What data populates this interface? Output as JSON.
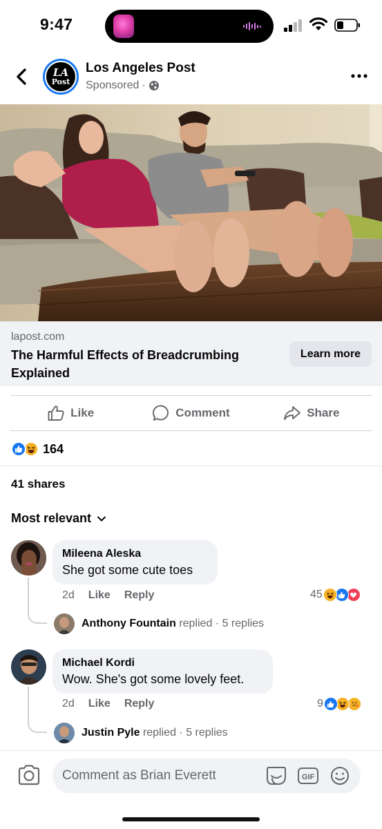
{
  "status_bar": {
    "time": "9:47"
  },
  "post": {
    "page_name": "Los Angeles Post",
    "logo_text_top": "LA",
    "logo_text_bottom": "Post",
    "sponsored_label": "Sponsored",
    "separator": "·",
    "link": {
      "domain": "lapost.com",
      "title": "The Harmful Effects of Breadcrumbing Explained",
      "cta": "Learn more"
    },
    "actions": {
      "like": "Like",
      "comment": "Comment",
      "share": "Share"
    },
    "reaction_count": "164",
    "shares": "41 shares",
    "sort_label": "Most relevant"
  },
  "comments": [
    {
      "author": "Mileena Aleska",
      "text": "She got some cute toes",
      "time": "2d",
      "like_label": "Like",
      "reply_label": "Reply",
      "reaction_count": "45",
      "reactions": [
        "haha",
        "like",
        "love"
      ],
      "reply_preview": {
        "author": "Anthony Fountain",
        "verb": "replied",
        "count": "5 replies"
      }
    },
    {
      "author": "Michael Kordi",
      "text": "Wow. She's got some lovely feet.",
      "time": "2d",
      "like_label": "Like",
      "reply_label": "Reply",
      "reaction_count": "9",
      "reactions": [
        "like",
        "haha",
        "care"
      ],
      "reply_preview": {
        "author": "Justin Pyle",
        "verb": "replied",
        "count": "5 replies"
      }
    }
  ],
  "composer": {
    "placeholder": "Comment as Brian Everett",
    "gif_label": "GIF"
  },
  "colors": {
    "facebook_blue": "#1877f2",
    "secondary_text": "#65676b",
    "bubble_bg": "#f0f2f5",
    "haha_yellow": "#f7b125",
    "love_red": "#f33e58"
  },
  "icons": [
    "back-arrow-icon",
    "globe-icon",
    "more-icon",
    "like-icon",
    "comment-icon",
    "share-icon",
    "chevron-down-icon",
    "camera-icon",
    "sticker-icon",
    "gif-icon",
    "emoji-icon"
  ]
}
